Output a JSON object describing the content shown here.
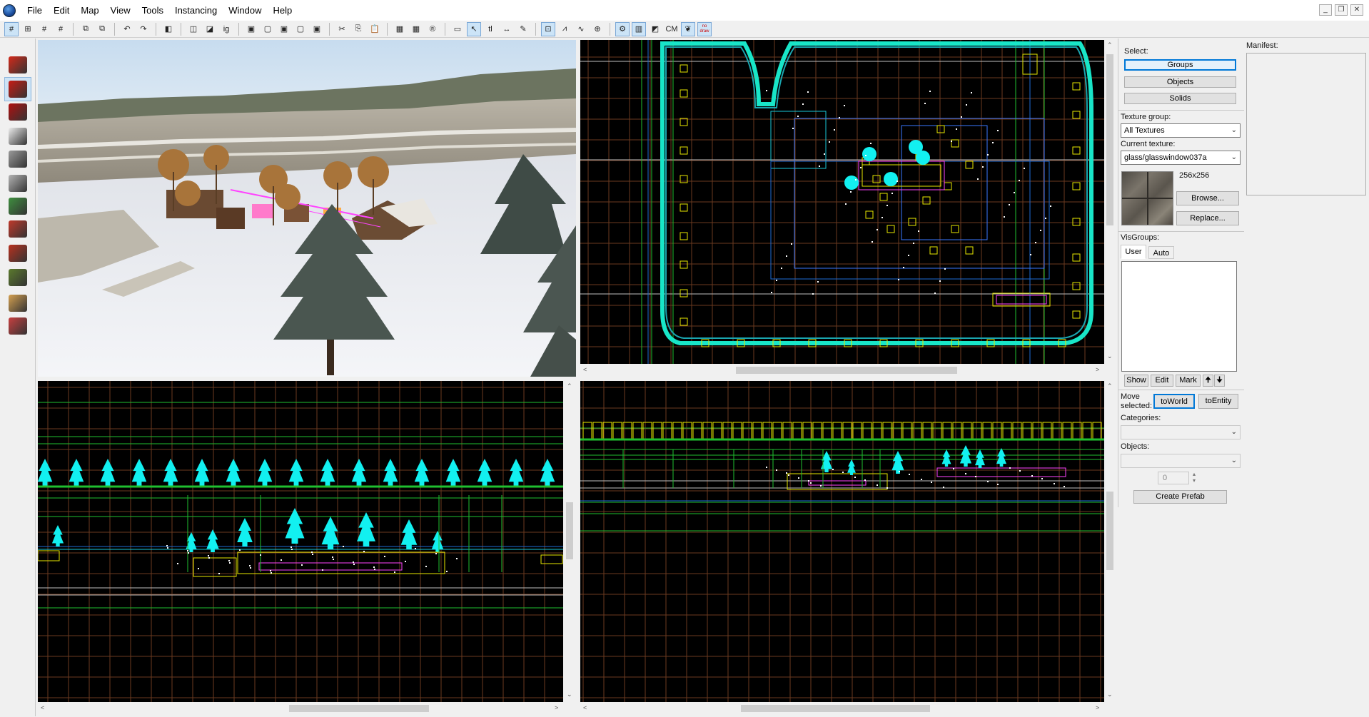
{
  "menu": {
    "items": [
      "File",
      "Edit",
      "Map",
      "View",
      "Tools",
      "Instancing",
      "Window",
      "Help"
    ]
  },
  "window_controls": {
    "minimize": "_",
    "restore": "❐",
    "close": "✕"
  },
  "toolbar": {
    "buttons": [
      {
        "name": "grid-toggle-icon",
        "glyph": "#",
        "active": true
      },
      {
        "name": "grid-smaller-icon",
        "glyph": "⊞"
      },
      {
        "name": "grid-larger-icon",
        "glyph": "#"
      },
      {
        "name": "grid-dots-icon",
        "glyph": "#"
      },
      {
        "name": "sep"
      },
      {
        "name": "group-icon",
        "glyph": "⧉"
      },
      {
        "name": "ungroup-icon",
        "glyph": "⧉"
      },
      {
        "name": "sep"
      },
      {
        "name": "undo-icon",
        "glyph": "↶"
      },
      {
        "name": "redo-icon",
        "glyph": "↷"
      },
      {
        "name": "sep"
      },
      {
        "name": "carve-icon",
        "glyph": "◧"
      },
      {
        "name": "sep"
      },
      {
        "name": "hide-selected-icon",
        "glyph": "◫"
      },
      {
        "name": "hide-unselected-icon",
        "glyph": "◪"
      },
      {
        "name": "ignore-groups-icon",
        "glyph": "ig"
      },
      {
        "name": "sep"
      },
      {
        "name": "cordon-icon",
        "glyph": "▣"
      },
      {
        "name": "cordon-toggle-icon",
        "glyph": "▢"
      },
      {
        "name": "cordon-edit-icon",
        "glyph": "▣"
      },
      {
        "name": "cordon-new-icon",
        "glyph": "▢"
      },
      {
        "name": "cordon-apply-icon",
        "glyph": "▣"
      },
      {
        "name": "sep"
      },
      {
        "name": "cut-icon",
        "glyph": "✂"
      },
      {
        "name": "copy-icon",
        "glyph": "⎘"
      },
      {
        "name": "paste-icon",
        "glyph": "📋"
      },
      {
        "name": "sep"
      },
      {
        "name": "toggle-helpers-icon",
        "glyph": "▦"
      },
      {
        "name": "toggle-models-icon",
        "glyph": "▦"
      },
      {
        "name": "radius-culling-icon",
        "glyph": "®"
      },
      {
        "name": "sep"
      },
      {
        "name": "selection-box-icon",
        "glyph": "▭"
      },
      {
        "name": "select-pointer-icon",
        "glyph": "↖",
        "active": true
      },
      {
        "name": "texture-lock-icon",
        "glyph": "tl"
      },
      {
        "name": "scale-lock-icon",
        "glyph": "↔"
      },
      {
        "name": "brush-pen-icon",
        "glyph": "✎"
      },
      {
        "name": "sep"
      },
      {
        "name": "toggle-3d-grid-icon",
        "glyph": "⊡",
        "active": true
      },
      {
        "name": "toggle-cameras-icon",
        "glyph": "⩘"
      },
      {
        "name": "toggle-audio-icon",
        "glyph": "∿"
      },
      {
        "name": "toggle-spawn-icon",
        "glyph": "⊕"
      },
      {
        "name": "sep"
      },
      {
        "name": "toggle-displacement-icon",
        "glyph": "⚙",
        "active": true
      },
      {
        "name": "toggle-solids-icon",
        "glyph": "▥",
        "active": true
      },
      {
        "name": "toggle-instances-icon",
        "glyph": "◩"
      },
      {
        "name": "cubemap-label-icon",
        "glyph": "CM"
      },
      {
        "name": "leaf-icon",
        "glyph": "❦",
        "active": true
      },
      {
        "name": "draw-toggle-icon",
        "glyph": "no draw",
        "active": true
      }
    ]
  },
  "left_tools": [
    {
      "name": "selection-tool-icon",
      "color": "#d42a1a",
      "active": false
    },
    {
      "name": "magnify-tool-icon",
      "color": "#c81c14",
      "active": true
    },
    {
      "name": "camera-tool-icon",
      "color": "#b01010",
      "active": false
    },
    {
      "name": "entity-tool-icon",
      "color": "#ededed",
      "active": false
    },
    {
      "name": "block-tool-icon",
      "color": "#9a9a9a",
      "active": false
    },
    {
      "name": "texture-app-tool-icon",
      "color": "#b4b4b4",
      "active": false
    },
    {
      "name": "apply-texture-icon",
      "color": "#3f8f3f",
      "active": false
    },
    {
      "name": "decal-tool-icon",
      "color": "#c0392b",
      "active": false
    },
    {
      "name": "overlay-tool-icon",
      "color": "#b8321f",
      "active": false
    },
    {
      "name": "clip-tool-icon",
      "color": "#5b7a2d",
      "active": false
    },
    {
      "name": "vertex-tool-icon",
      "color": "#d4a050",
      "active": false
    },
    {
      "name": "path-tool-icon",
      "color": "#c84040",
      "active": false
    }
  ],
  "panel": {
    "select_label": "Select:",
    "groups_button": "Groups",
    "objects_button": "Objects",
    "solids_button": "Solids",
    "texture_group_label": "Texture group:",
    "texture_group_value": "All Textures",
    "current_texture_label": "Current texture:",
    "current_texture_value": "glass/glasswindow037a",
    "texture_size": "256x256",
    "browse_button": "Browse...",
    "replace_button": "Replace...",
    "visgroups_label": "VisGroups:",
    "tab_user": "User",
    "tab_auto": "Auto",
    "show_button": "Show",
    "edit_button": "Edit",
    "mark_button": "Mark",
    "up_arrow": "🠉",
    "down_arrow": "🠋",
    "move_selected_label_1": "Move",
    "move_selected_label_2": "selected:",
    "to_world_button": "toWorld",
    "to_entity_button": "toEntity",
    "categories_label": "Categories:",
    "objects_label": "Objects:",
    "spinner_value": "0",
    "create_prefab_button": "Create Prefab"
  },
  "manifest": {
    "label": "Manifest:"
  }
}
